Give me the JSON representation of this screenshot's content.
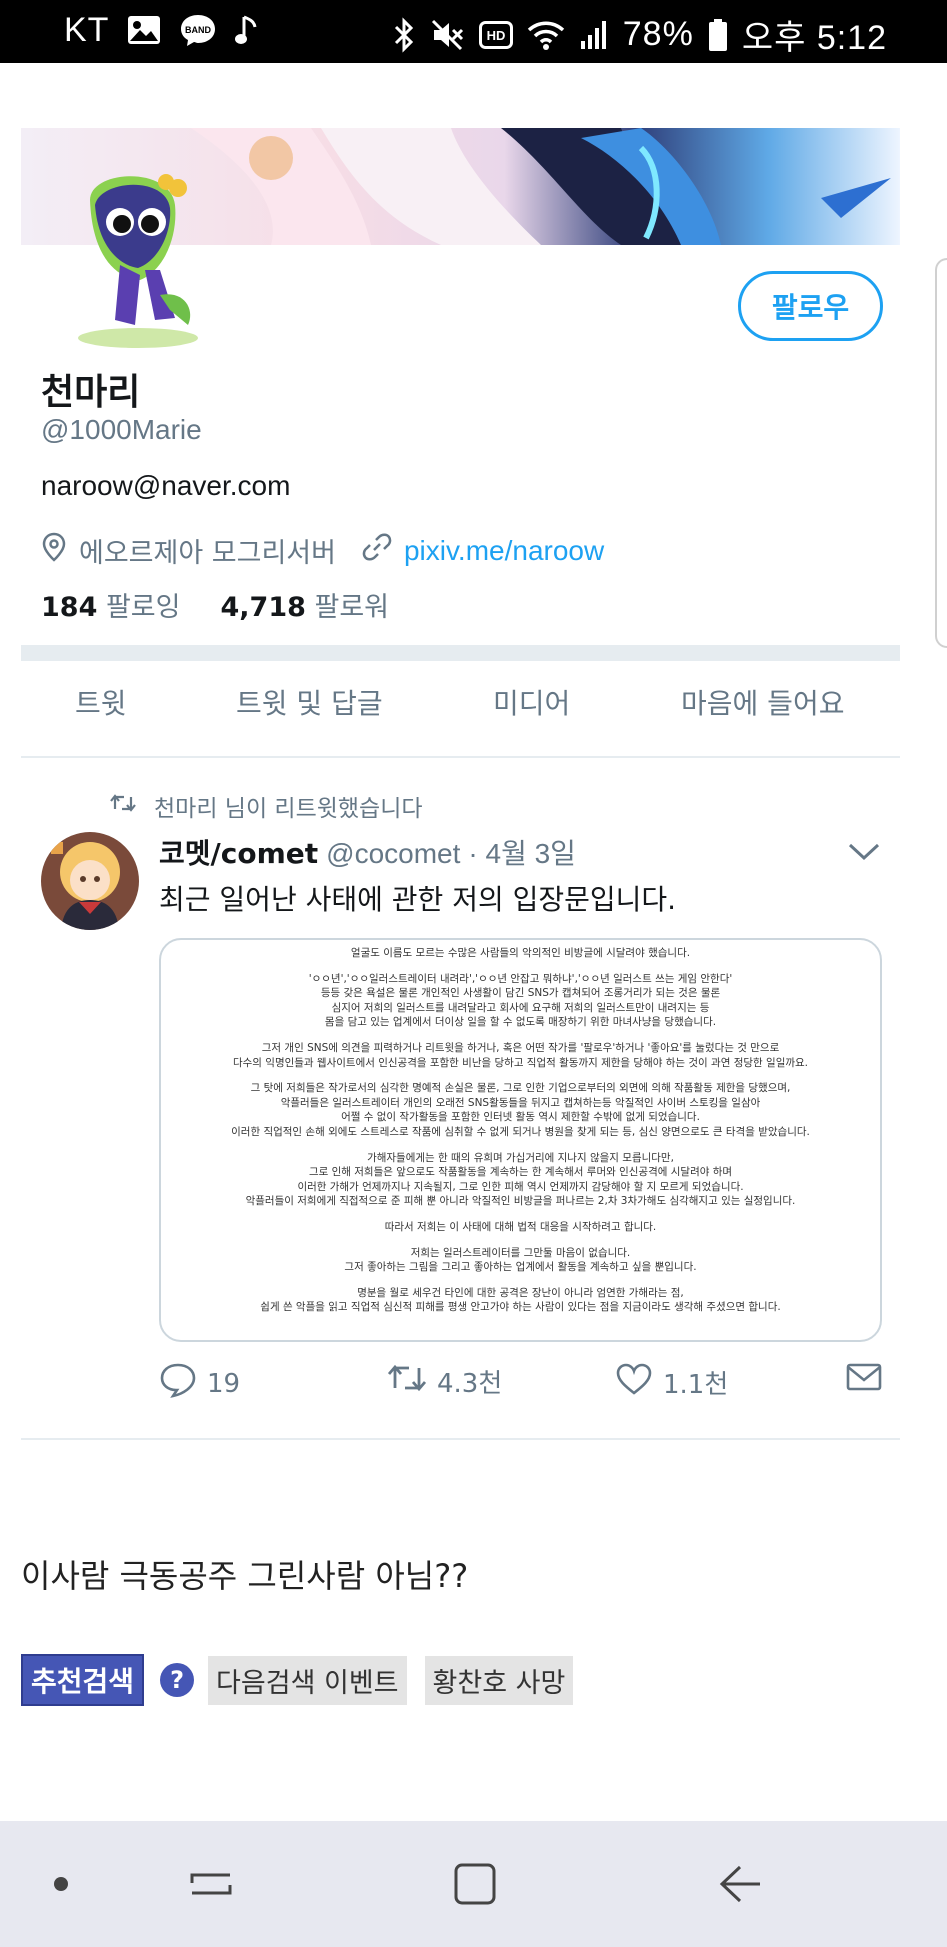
{
  "status_bar": {
    "carrier": "KT",
    "battery": "78%",
    "time": "오후 5:12",
    "left_icons": [
      "gallery-icon",
      "band-icon",
      "music-note-icon"
    ],
    "right_icons": [
      "bluetooth-icon",
      "mute-icon",
      "hd-icon",
      "wifi-icon",
      "signal-icon",
      "battery-icon"
    ],
    "band_label": "BAND",
    "hd_label": "HD"
  },
  "profile": {
    "name": "천마리",
    "handle": "@1000Marie",
    "bio": "naroow@naver.com",
    "location": "에오르제아 모그리서버",
    "link": "pixiv.me/naroow",
    "following_count": "184",
    "following_label": "팔로잉",
    "followers_count": "4,718",
    "followers_label": "팔로워",
    "follow_button": "팔로우"
  },
  "tabs": [
    "트윗",
    "트윗 및 답글",
    "미디어",
    "마음에 들어요"
  ],
  "tweet": {
    "retweet_notice": "천마리 님이 리트윗했습니다",
    "author_name": "코멧/comet",
    "author_handle": "@cocomet",
    "date": "· 4월 3일",
    "text": "최근 일어난 사태에 관한 저의 입장문입니다.",
    "card_lines": [
      "얼굴도 이름도 모르는 수많은 사람들의 악의적인 비방글에 시달려야 했습니다.",
      "",
      "'ㅇㅇ년','ㅇㅇ일러스트레이터 내려라','ㅇㅇ년 안잡고 뭐하냐','ㅇㅇ년 일러스트 쓰는 게임 안한다'",
      "등등 갖은 욕설은 물론 개인적인 사생활이 담긴 SNS가 캡쳐되어 조롱거리가 되는 것은 물론",
      "심지어 저희의 일러스트를 내려달라고 회사에 요구해 저희의 일러스트만이 내려지는 등",
      "몸을 담고 있는 업계에서 더이상 일을 할 수 없도록 매장하기 위한 마녀사냥을 당했습니다.",
      "",
      "그저 개인 SNS에 의견을 피력하거나 리트윗을 하거나, 혹은 어떤 작가를 '팔로우'하거나 '좋아요'를 눌렀다는 것 만으로",
      "다수의 익명인들과 웹사이트에서 인신공격을 포함한 비난을 당하고 직업적 활동까지 제한을 당해야 하는 것이 과연 정당한 일일까요.",
      "",
      "그 탓에 저희들은 작가로서의 심각한 명예적 손실은 물론, 그로 인한 기업으로부터의 외면에 의해 작품활동 제한을 당했으며,",
      "악플러들은 일러스트레이터 개인의 오래전 SNS활동들을 뒤지고 캡쳐하는등 악질적인 사이버 스토킹을 일삼아",
      "어쩔 수 없이 작가활동을 포함한 인터넷 활동 역시 제한할 수밖에 없게 되었습니다.",
      "이러한 직업적인 손해 외에도 스트레스로 작품에 심취할 수 없게 되거나 병원을 찾게 되는 등, 심신 양면으로도 큰 타격을 받았습니다.",
      "",
      "가해자들에게는 한 때의 유희며 가십거리에 지나지 않을지 모릅니다만,",
      "그로 인해 저희들은 앞으로도 작품활동을 계속하는 한 계속해서 루머와 인신공격에 시달려야 하며",
      "이러한 가해가 언제까지나 지속될지, 그로 인한 피해 역시 언제까지 감당해야 할 지 모르게 되었습니다.",
      "악플러들이 저희에게 직접적으로 준 피해 뿐 아니라 악질적인 비방글을 퍼나르는 2,차 3차가해도 심각해지고 있는 실정입니다.",
      "",
      "따라서 저희는 이 사태에 대해 법적 대응을 시작하려고 합니다.",
      "",
      "저희는 일러스트레이터를 그만둘 마음이 없습니다.",
      "그저 좋아하는 그림을 그리고 좋아하는 업계에서 활동을 계속하고 싶을 뿐입니다.",
      "",
      "명분을 월로 세우건 타인에 대한 공격은 장난이 아니라 엄연한 가해라는 점,",
      "쉽게 쓴 악플을 읽고 직업적 심신적 피해를 평생 안고가야 하는 사람이 있다는 점을 지금이라도 생각해 주셨으면 합니다."
    ],
    "reply_count": "19",
    "retweet_count": "4.3천",
    "like_count": "1.1천"
  },
  "page": {
    "comment": "이사람 극동공주 그린사람 아님??",
    "recommend_badge": "추천검색",
    "help_icon_label": "?",
    "recommend_chips": [
      "다음검색 이벤트",
      "황찬호 사망"
    ]
  },
  "colors": {
    "twitter_blue": "#1da1f2",
    "gray_text": "#657786",
    "divider": "#e6ecf0",
    "recommend_badge": "#4556b5",
    "navbar": "#e7e8f0"
  }
}
